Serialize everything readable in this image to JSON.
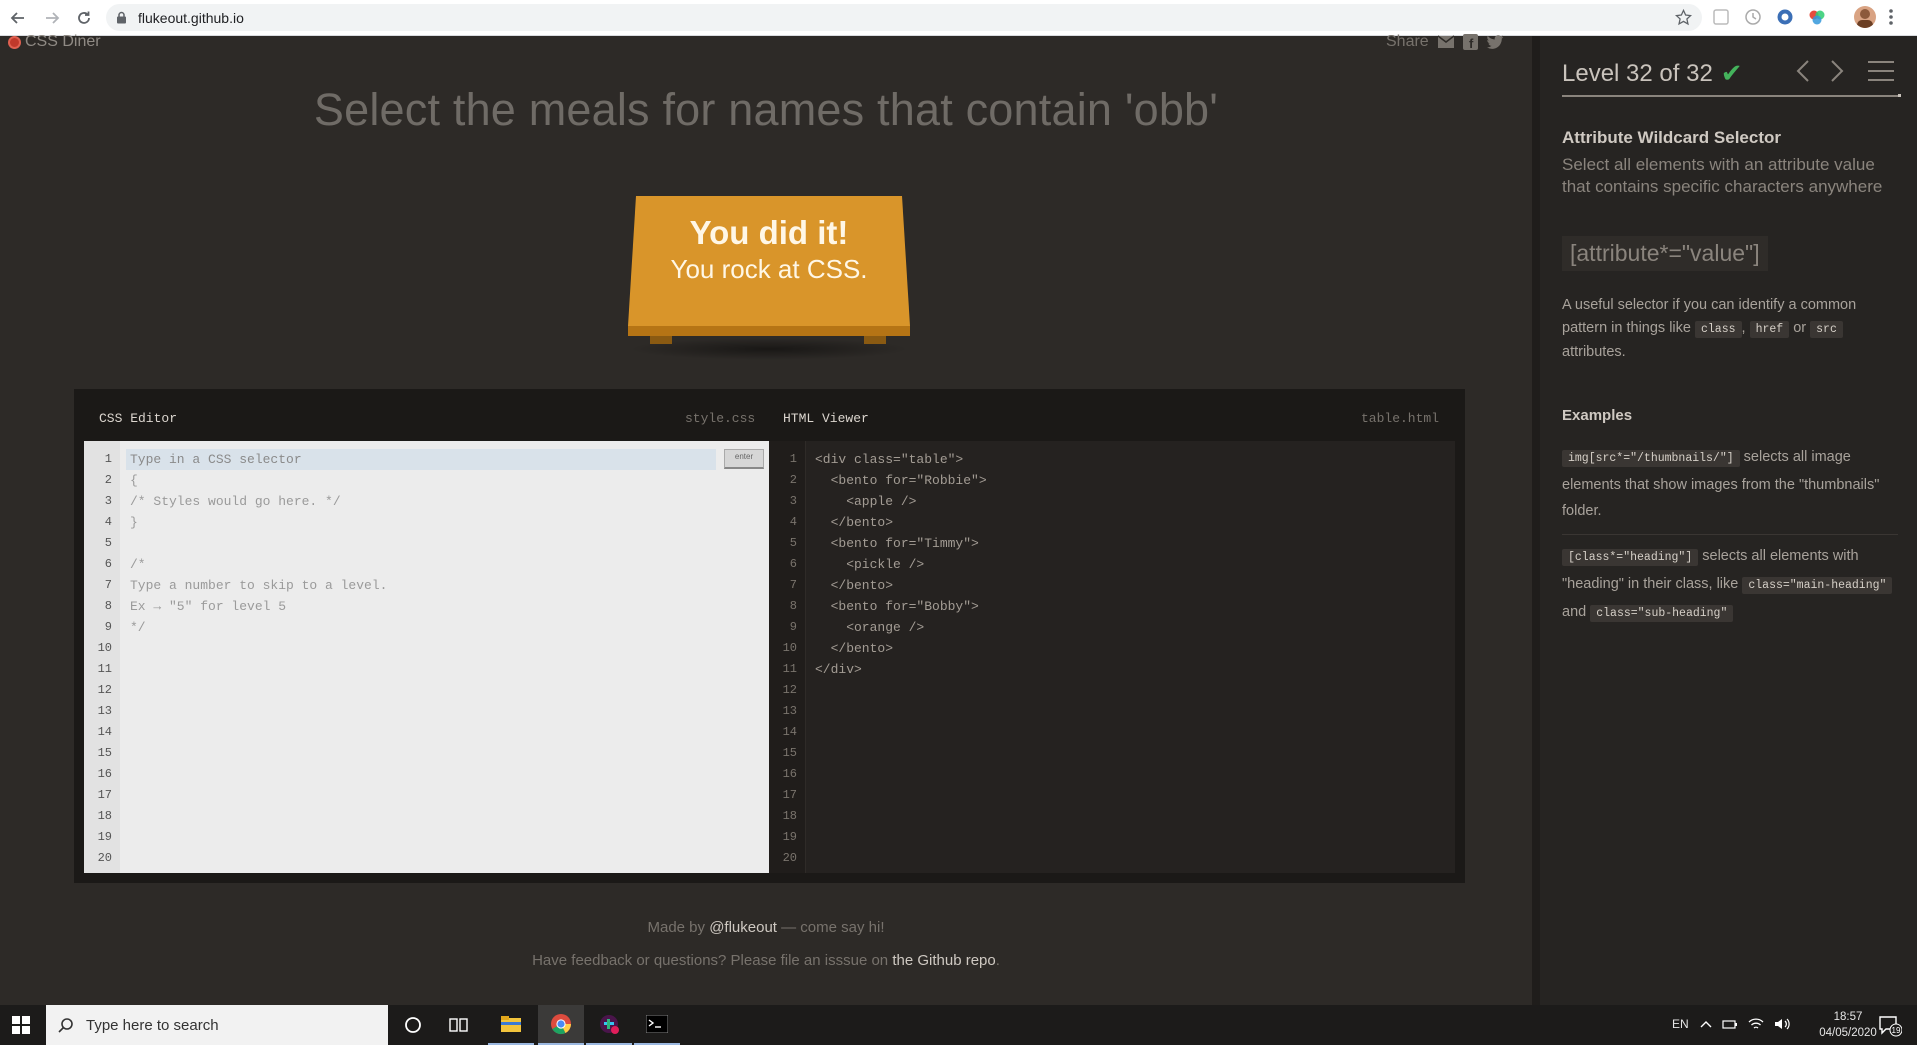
{
  "browser": {
    "url": "flukeout.github.io",
    "icons": [
      "back-arrow-icon",
      "forward-arrow-icon",
      "reload-icon",
      "lock-icon",
      "star-icon",
      "kebab-menu-icon"
    ]
  },
  "game": {
    "logo": "CSS Diner",
    "share_label": "Share",
    "order": "Select the meals for names that contain 'obb'",
    "win_line1": "You did it!",
    "win_line2": "You rock at CSS.",
    "css_editor": {
      "title": "CSS Editor",
      "file": "style.css",
      "placeholder": "Type in a CSS selector",
      "enter_label": "enter",
      "lines": [
        "",
        "{",
        "/* Styles would go here. */",
        "}",
        "",
        "/*",
        "Type a number to skip to a level.",
        "Ex → \"5\" for level 5",
        "*/"
      ]
    },
    "html_viewer": {
      "title": "HTML Viewer",
      "file": "table.html",
      "lines": [
        "<div class=\"table\">",
        "  <bento for=\"Robbie\">",
        "    <apple />",
        "  </bento>",
        "  <bento for=\"Timmy\">",
        "    <pickle />",
        "  </bento>",
        "  <bento for=\"Bobby\">",
        "    <orange />",
        "  </bento>",
        "</div>"
      ]
    },
    "line_numbers": [
      "1",
      "2",
      "3",
      "4",
      "5",
      "6",
      "7",
      "8",
      "9",
      "10",
      "11",
      "12",
      "13",
      "14",
      "15",
      "16",
      "17",
      "18",
      "19",
      "20"
    ],
    "footer": {
      "made_by_pre": "Made by ",
      "made_by_link": "@flukeout",
      "made_by_post": " — come say hi!",
      "feedback_pre": "Have feedback or questions? Please file an isssue on ",
      "feedback_link": "the Github repo",
      "feedback_post": "."
    }
  },
  "sidebar": {
    "level": "Level 32 of 32",
    "progress": 1.0,
    "selector_name": "Attribute Wildcard Selector",
    "selector_desc": "Select all elements with an attribute value that contains specific characters anywhere",
    "syntax": "[attribute*=\"value\"]",
    "help_pre": "A useful selector if you can identify a common pattern in things like ",
    "help_code1": "class",
    "help_sep1": ",",
    "help_code2": "href",
    "help_sep2": "or",
    "help_code3": "src",
    "help_post": "attributes.",
    "examples_title": "Examples",
    "example1_code": "img[src*=\"/thumbnails/\"]",
    "example1_text": "selects all image elements that show images from the \"thumbnails\" folder.",
    "example2_code": "[class*=\"heading\"]",
    "example2_text_pre": "selects all elements with \"heading\" in their class, like",
    "example2_code2": "class=\"main-heading\"",
    "example2_and": "and",
    "example2_code3": "class=\"sub-heading\""
  },
  "taskbar": {
    "search_placeholder": "Type here to search",
    "language": "EN",
    "time": "18:57",
    "date": "04/05/2020",
    "notification_count": "19",
    "apps": [
      "cortana-icon",
      "task-view-icon",
      "file-explorer-icon",
      "chrome-icon",
      "slack-icon",
      "terminal-icon"
    ]
  }
}
